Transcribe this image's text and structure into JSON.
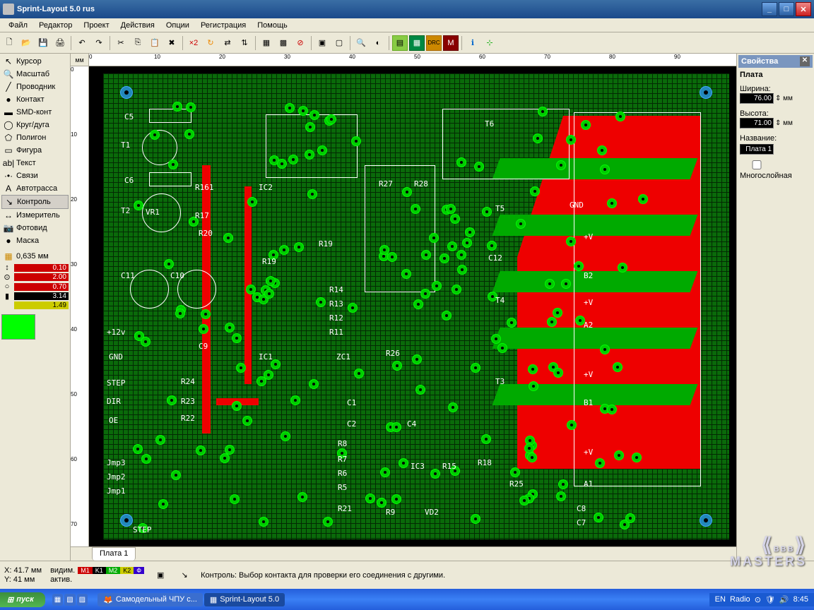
{
  "titlebar": {
    "title": "Sprint-Layout 5.0 rus"
  },
  "menu": [
    "Файл",
    "Редактор",
    "Проект",
    "Действия",
    "Опции",
    "Регистрация",
    "Помощь"
  ],
  "tools": [
    {
      "name": "cursor",
      "label": "Курсор",
      "icon": "↖"
    },
    {
      "name": "zoom",
      "label": "Масштаб",
      "icon": "🔍"
    },
    {
      "name": "wire",
      "label": "Проводник",
      "icon": "╱"
    },
    {
      "name": "pad",
      "label": "Контакт",
      "icon": "●"
    },
    {
      "name": "smd",
      "label": "SMD-конт",
      "icon": "▬"
    },
    {
      "name": "arc",
      "label": "Круг/дуга",
      "icon": "◯"
    },
    {
      "name": "poly",
      "label": "Полигон",
      "icon": "⬠"
    },
    {
      "name": "shape",
      "label": "Фигура",
      "icon": "▭"
    },
    {
      "name": "text",
      "label": "Текст",
      "icon": "ab|"
    },
    {
      "name": "link",
      "label": "Связи",
      "icon": "·•·"
    },
    {
      "name": "auto",
      "label": "Автотрасса",
      "icon": "A"
    },
    {
      "name": "test",
      "label": "Контроль",
      "icon": "↘",
      "active": true
    },
    {
      "name": "meas",
      "label": "Измеритель",
      "icon": "↔"
    },
    {
      "name": "photo",
      "label": "Фотовид",
      "icon": "📷"
    },
    {
      "name": "mask",
      "label": "Маска",
      "icon": "●"
    }
  ],
  "grid": {
    "label": "0,635 мм"
  },
  "params": [
    {
      "icon": "↕",
      "val": "0.10",
      "cls": "red"
    },
    {
      "icon": "⊙",
      "val": "2.00",
      "cls": "red"
    },
    {
      "icon": "○",
      "val": "0.70",
      "cls": "red"
    },
    {
      "icon": "▮",
      "val": "3.14",
      "cls": ""
    },
    {
      "icon": "",
      "val": "1.49",
      "cls": "yel"
    }
  ],
  "ruler_unit": "мм",
  "ruler_h": [
    "0",
    "10",
    "20",
    "30",
    "40",
    "50",
    "60",
    "70",
    "80",
    "90"
  ],
  "ruler_v": [
    "0",
    "10",
    "20",
    "30",
    "40",
    "50",
    "60",
    "70"
  ],
  "silkscreen": [
    "C5",
    "T1",
    "C6",
    "T2",
    "VR1",
    "R161",
    "R17",
    "R20",
    "C11",
    "C10",
    "+12v",
    "GND",
    "C9",
    "STEP",
    "DIR",
    "OE",
    "Jmp3",
    "Jmp2",
    "Jmp1",
    "STEP",
    "IC2",
    "R19",
    "IC1",
    "R24",
    "R23",
    "R22",
    "R14",
    "R13",
    "R12",
    "R11",
    "ZC1",
    "C1",
    "C2",
    "R8",
    "R7",
    "R6",
    "R5",
    "R21",
    "R27",
    "R28",
    "R19",
    "R26",
    "C4",
    "IC3",
    "R9",
    "T6",
    "T5",
    "C12",
    "T4",
    "T3",
    "GND",
    "+V",
    "B2",
    "+V",
    "A2",
    "+V",
    "B1",
    "+V",
    "A1",
    "R18",
    "R25",
    "C8",
    "C7",
    "VD2",
    "R15"
  ],
  "tabs": [
    {
      "label": "Плата 1"
    }
  ],
  "properties": {
    "header": "Свойства",
    "section": "Плата",
    "width_label": "Ширина:",
    "width_val": "76.00",
    "height_label": "Высота:",
    "height_val": "71.00",
    "unit_suffix": "⇕ мм",
    "name_label": "Название:",
    "name_val": "Плата 1",
    "multilayer": "Многослойная"
  },
  "status": {
    "x_label": "X:",
    "x_val": "41.7 мм",
    "y_label": "Y:",
    "y_val": "   41 мм",
    "vis_label": "видим.",
    "act_label": "актив.",
    "layers": [
      {
        "txt": "M1",
        "bg": "#c00"
      },
      {
        "txt": "K1",
        "bg": "#000"
      },
      {
        "txt": "M2",
        "bg": "#0a0"
      },
      {
        "txt": "K2",
        "bg": "#cc0",
        "fg": "#000"
      },
      {
        "txt": "Ф",
        "bg": "#30c"
      }
    ],
    "hint": "Контроль: Выбор контакта для проверки его соединения с другими."
  },
  "taskbar": {
    "start": "пуск",
    "items": [
      {
        "label": "Самодельный ЧПУ с...",
        "icon": "🦊"
      },
      {
        "label": "Sprint-Layout 5.0",
        "icon": "▦",
        "active": true
      }
    ],
    "tray": {
      "lang": "EN",
      "radio": "Radio",
      "time": "8:45"
    }
  },
  "watermark": {
    "l1": "BBB",
    "l2": "MASTERS"
  }
}
